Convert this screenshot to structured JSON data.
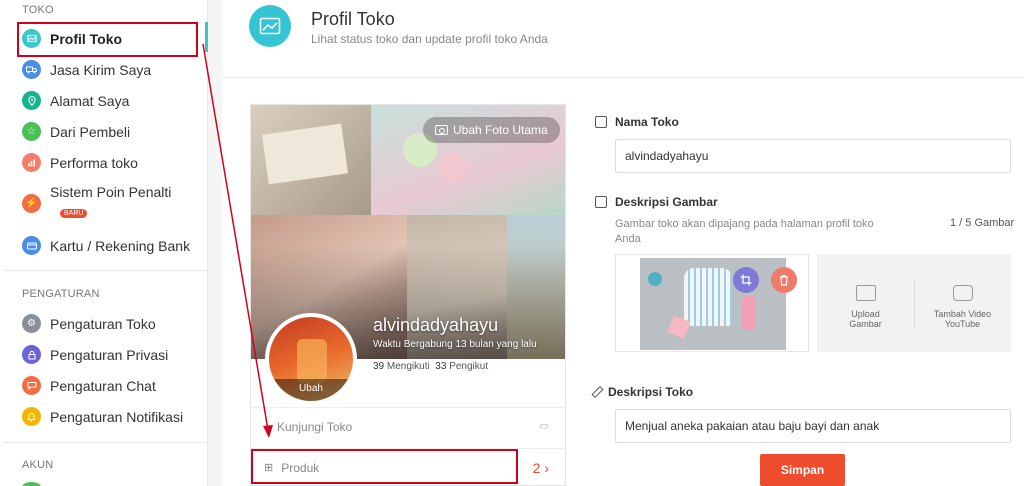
{
  "sidebar": {
    "section_toko": "TOKO",
    "section_pengaturan": "PENGATURAN",
    "section_akun": "AKUN",
    "toko_items": [
      {
        "label": "Profil Toko",
        "icon": "store-icon",
        "color": "#3dc6c9"
      },
      {
        "label": "Jasa Kirim Saya",
        "icon": "truck-icon",
        "color": "#4a8fe7"
      },
      {
        "label": "Alamat Saya",
        "icon": "location-icon",
        "color": "#18b48e"
      },
      {
        "label": "Dari Pembeli",
        "icon": "star-icon",
        "color": "#4cbf55"
      },
      {
        "label": "Performa toko",
        "icon": "chart-icon",
        "color": "#f57e6a"
      },
      {
        "label": "Sistem Poin Penalti",
        "icon": "warning-icon",
        "color": "#f36c42"
      },
      {
        "label": "Kartu / Rekening Bank",
        "icon": "card-icon",
        "color": "#4a8fe7"
      }
    ],
    "badge_baru": "BARU",
    "pengaturan_items": [
      {
        "label": "Pengaturan Toko",
        "icon": "gear-icon",
        "color": "#8a8f98"
      },
      {
        "label": "Pengaturan Privasi",
        "icon": "lock-icon",
        "color": "#6b63d6"
      },
      {
        "label": "Pengaturan Chat",
        "icon": "chat-icon",
        "color": "#f36c42"
      },
      {
        "label": "Pengaturan Notifikasi",
        "icon": "bell-icon",
        "color": "#f5b400"
      }
    ]
  },
  "header": {
    "title": "Profil Toko",
    "subtitle": "Lihat status toko dan update profil toko Anda"
  },
  "profile_card": {
    "change_cover": "Ubah Foto Utama",
    "shop_name": "alvindadyahayu",
    "join_time": "Waktu Bergabung 13 bulan yang lalu",
    "following_count": "39",
    "following_label": "Mengikuti",
    "followers_count": "33",
    "followers_label": "Pengikut",
    "avatar_change": "Ubah",
    "visit_shop": "Kunjungi Toko",
    "products_label": "Produk",
    "products_count": "2"
  },
  "form": {
    "shop_name_label": "Nama Toko",
    "shop_name_value": "alvindadyahayu",
    "image_desc_label": "Deskripsi Gambar",
    "image_hint": "Gambar toko akan dipajang pada halaman profil toko Anda",
    "image_count": "1 / 5 Gambar",
    "upload_image": "Upload Gambar",
    "add_video": "Tambah Video YouTube",
    "shop_desc_label": "Deskripsi Toko",
    "shop_desc_value": "Menjual aneka pakaian atau baju bayi dan anak",
    "save_button": "Simpan"
  },
  "colors": {
    "accent": "#ee4d2d",
    "teal": "#3dc6c9",
    "annotation_red": "#d0021b"
  }
}
